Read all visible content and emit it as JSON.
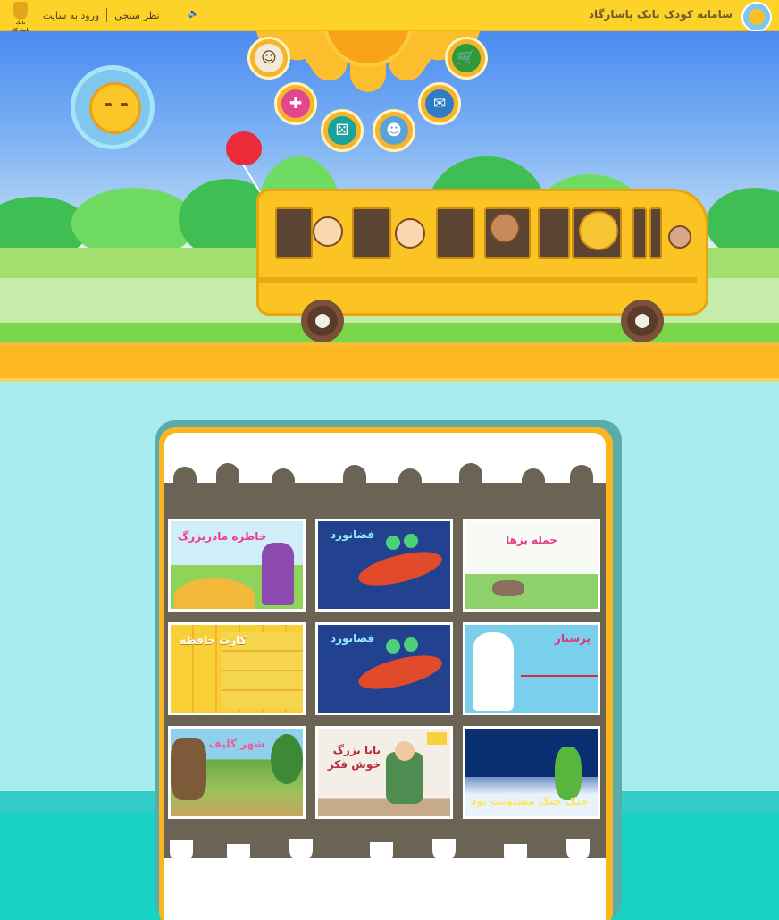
{
  "header": {
    "site_title": "سامانه کودک بانک پاسارگاد",
    "links": [
      "نظر سنجی",
      "ورود به سایت"
    ],
    "bank_caption": "بانک پاسارگاد"
  },
  "sun_menu": {
    "items": [
      "avatar-icon",
      "shopping-cart-icon",
      "gamepad-icon",
      "dice-icon",
      "kid-face-icon",
      "gift-icon"
    ]
  },
  "games": [
    {
      "title": "حمله بزها",
      "bg": "#f4f8f0",
      "color": "#e33e84"
    },
    {
      "title": "فضانورد",
      "bg": "#1f3c88",
      "color": "#8cf0ff"
    },
    {
      "title": "خاطره مادربزرگ",
      "bg": "#8fd8f0",
      "color": "#ef3e85"
    },
    {
      "title": "پرستار",
      "bg": "#7fd3ec",
      "color": "#e4317f"
    },
    {
      "title": "فضانورد",
      "bg": "#1f3c88",
      "color": "#8cf0ff"
    },
    {
      "title": "کارت حافظه",
      "bg": "#f7d437",
      "color": "#ffffff"
    },
    {
      "title": "جیک جیک مستونت بود",
      "bg": "#0e3680",
      "color": "#ffe65c"
    },
    {
      "title": "بابا بزرگ خوش فکر",
      "bg": "#f3efe6",
      "color": "#b42d3a"
    },
    {
      "title": "شهر گلیف",
      "bg": "#5ca3c9",
      "color": "#f05aa0"
    }
  ]
}
